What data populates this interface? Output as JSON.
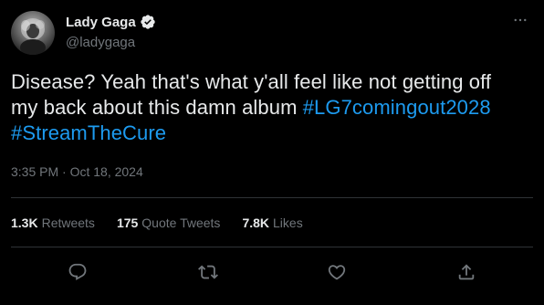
{
  "author": {
    "display_name": "Lady Gaga",
    "handle": "@ladygaga",
    "verified": true
  },
  "tweet": {
    "text_prefix": "Disease? Yeah that's what y'all feel like not getting off my back about this damn album ",
    "hashtags": [
      "#LG7comingout2028",
      "#StreamTheCure"
    ],
    "time": "3:35 PM",
    "separator": " · ",
    "date": "Oct 18, 2024"
  },
  "stats": {
    "retweets": {
      "count": "1.3K",
      "label": "Retweets"
    },
    "quote_tweets": {
      "count": "175",
      "label": "Quote Tweets"
    },
    "likes": {
      "count": "7.8K",
      "label": "Likes"
    }
  },
  "colors": {
    "background": "#000000",
    "text": "#e7e9ea",
    "muted": "#71767b",
    "link": "#1d9bf0",
    "divider": "#2f3336"
  },
  "icons": [
    "more-icon",
    "verified-icon",
    "reply-icon",
    "retweet-icon",
    "like-icon",
    "share-icon"
  ]
}
